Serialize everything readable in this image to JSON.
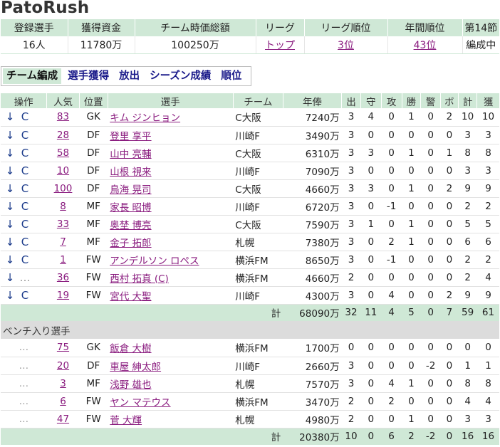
{
  "app_title": "PatoRush",
  "summary": {
    "headers": [
      "登録選手",
      "獲得資金",
      "チーム時価総額",
      "リーグ",
      "リーグ順位",
      "年間順位",
      "第14節"
    ],
    "values": {
      "players": "16人",
      "funds": "11780万",
      "team_value": "100250万",
      "league": "トップ",
      "league_rank": "3位",
      "annual_rank": "43位",
      "round_status": "編成中"
    }
  },
  "tabs": [
    "チーム編成",
    "選手獲得",
    "放出",
    "シーズン成績",
    "順位"
  ],
  "table": {
    "headers": [
      "操作",
      "人気",
      "位置",
      "選手",
      "チーム",
      "年俸",
      "出",
      "守",
      "攻",
      "勝",
      "警",
      "ボ",
      "計",
      "獲"
    ],
    "arrow_glyph": "↓",
    "captain_glyph": "C",
    "dots_glyph": "…",
    "starters": [
      {
        "op2": "C",
        "pop": "83",
        "pos": "GK",
        "name": "キム ジンヒョン",
        "team": "C大阪",
        "salary": "7240万",
        "s1": "3",
        "s2": "4",
        "s3": "0",
        "s4": "1",
        "s5": "0",
        "s6": "2",
        "s7": "10",
        "s8": "10"
      },
      {
        "op2": "C",
        "pop": "28",
        "pos": "DF",
        "name": "登里 享平",
        "team": "川崎F",
        "salary": "3490万",
        "s1": "3",
        "s2": "0",
        "s3": "0",
        "s4": "0",
        "s5": "0",
        "s6": "0",
        "s7": "3",
        "s8": "3"
      },
      {
        "op2": "C",
        "pop": "58",
        "pos": "DF",
        "name": "山中 亮輔",
        "team": "C大阪",
        "salary": "6310万",
        "s1": "3",
        "s2": "3",
        "s3": "0",
        "s4": "1",
        "s5": "0",
        "s6": "1",
        "s7": "8",
        "s8": "8"
      },
      {
        "op2": "C",
        "pop": "10",
        "pos": "DF",
        "name": "山根 視来",
        "team": "川崎F",
        "salary": "7090万",
        "s1": "3",
        "s2": "0",
        "s3": "0",
        "s4": "0",
        "s5": "0",
        "s6": "0",
        "s7": "3",
        "s8": "3"
      },
      {
        "op2": "C",
        "pop": "100",
        "pos": "DF",
        "name": "鳥海 晃司",
        "team": "C大阪",
        "salary": "4660万",
        "s1": "3",
        "s2": "3",
        "s3": "0",
        "s4": "1",
        "s5": "0",
        "s6": "2",
        "s7": "9",
        "s8": "9"
      },
      {
        "op2": "C",
        "pop": "8",
        "pos": "MF",
        "name": "家長 昭博",
        "team": "川崎F",
        "salary": "6720万",
        "s1": "3",
        "s2": "0",
        "s3": "-1",
        "s4": "0",
        "s5": "0",
        "s6": "0",
        "s7": "2",
        "s8": "2"
      },
      {
        "op2": "C",
        "pop": "33",
        "pos": "MF",
        "name": "奥埜 博亮",
        "team": "C大阪",
        "salary": "7590万",
        "s1": "3",
        "s2": "1",
        "s3": "0",
        "s4": "1",
        "s5": "0",
        "s6": "0",
        "s7": "5",
        "s8": "5"
      },
      {
        "op2": "C",
        "pop": "7",
        "pos": "MF",
        "name": "金子 拓郎",
        "team": "札幌",
        "salary": "7380万",
        "s1": "3",
        "s2": "0",
        "s3": "2",
        "s4": "1",
        "s5": "0",
        "s6": "0",
        "s7": "6",
        "s8": "6"
      },
      {
        "op2": "C",
        "pop": "1",
        "pos": "FW",
        "name": "アンデルソン ロペス",
        "team": "横浜FM",
        "salary": "8650万",
        "s1": "3",
        "s2": "0",
        "s3": "-1",
        "s4": "0",
        "s5": "0",
        "s6": "0",
        "s7": "2",
        "s8": "2"
      },
      {
        "op2": "…",
        "pop": "36",
        "pos": "FW",
        "name": "西村 拓真 (C)",
        "team": "横浜FM",
        "salary": "4660万",
        "s1": "2",
        "s2": "0",
        "s3": "0",
        "s4": "0",
        "s5": "0",
        "s6": "0",
        "s7": "2",
        "s8": "4"
      },
      {
        "op2": "C",
        "pop": "19",
        "pos": "FW",
        "name": "宮代 大聖",
        "team": "川崎F",
        "salary": "4300万",
        "s1": "3",
        "s2": "0",
        "s3": "4",
        "s4": "0",
        "s5": "0",
        "s6": "2",
        "s7": "9",
        "s8": "9"
      }
    ],
    "starters_total": {
      "label": "計",
      "salary": "68090万",
      "s1": "32",
      "s2": "11",
      "s3": "4",
      "s4": "5",
      "s5": "0",
      "s6": "7",
      "s7": "59",
      "s8": "61"
    },
    "bench_label": "ベンチ入り選手",
    "bench": [
      {
        "pop": "75",
        "pos": "GK",
        "name": "飯倉 大樹",
        "team": "横浜FM",
        "salary": "1700万",
        "s1": "0",
        "s2": "0",
        "s3": "0",
        "s4": "0",
        "s5": "0",
        "s6": "0",
        "s7": "0",
        "s8": "0"
      },
      {
        "pop": "20",
        "pos": "DF",
        "name": "車屋 紳太郎",
        "team": "川崎F",
        "salary": "2660万",
        "s1": "3",
        "s2": "0",
        "s3": "0",
        "s4": "0",
        "s5": "-2",
        "s6": "0",
        "s7": "1",
        "s8": "1"
      },
      {
        "pop": "3",
        "pos": "MF",
        "name": "浅野 雄也",
        "team": "札幌",
        "salary": "7570万",
        "s1": "3",
        "s2": "0",
        "s3": "4",
        "s4": "1",
        "s5": "0",
        "s6": "0",
        "s7": "8",
        "s8": "8"
      },
      {
        "pop": "6",
        "pos": "FW",
        "name": "ヤン マテウス",
        "team": "横浜FM",
        "salary": "3470万",
        "s1": "2",
        "s2": "0",
        "s3": "2",
        "s4": "0",
        "s5": "0",
        "s6": "0",
        "s7": "4",
        "s8": "4"
      },
      {
        "pop": "47",
        "pos": "FW",
        "name": "菅 大輝",
        "team": "札幌",
        "salary": "4980万",
        "s1": "2",
        "s2": "0",
        "s3": "0",
        "s4": "1",
        "s5": "0",
        "s6": "0",
        "s7": "3",
        "s8": "3"
      }
    ],
    "bench_total": {
      "label": "計",
      "salary": "20380万",
      "s1": "10",
      "s2": "0",
      "s3": "6",
      "s4": "2",
      "s5": "-2",
      "s6": "0",
      "s7": "16",
      "s8": "16"
    }
  },
  "colors": {
    "header_bg": "#cfe8d6",
    "link": "#8a1c7f",
    "tab_text": "#1a1a8a",
    "bench_bg": "#dcdcdc"
  }
}
